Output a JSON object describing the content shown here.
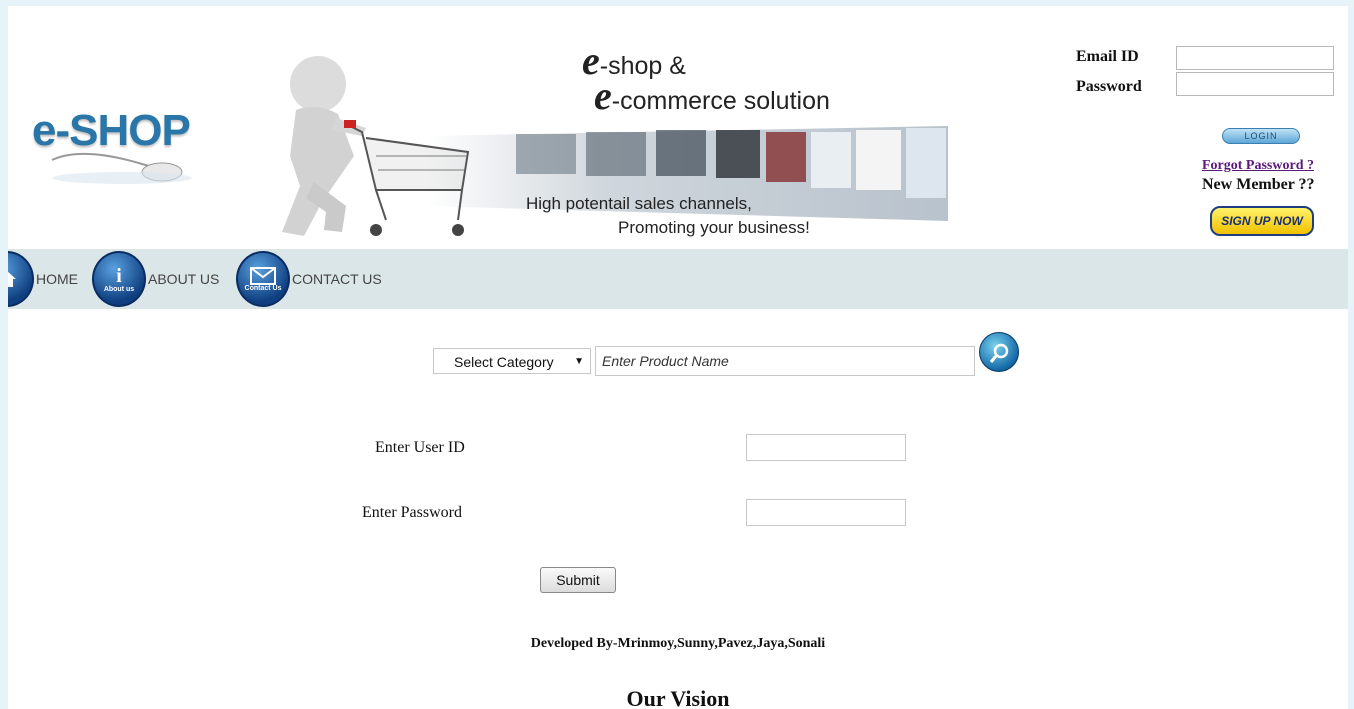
{
  "header": {
    "logo_text": "e-SHOP",
    "banner": {
      "line1_e": "e",
      "line1_text": "-shop &",
      "line2_e": "e",
      "line2_text": "-commerce solution",
      "tagline_line1": "High potentail sales channels,",
      "tagline_line2": "Promoting your business!"
    },
    "login": {
      "email_label": "Email ID",
      "password_label": "Password",
      "login_button": "LOGIN",
      "forgot_password": "Forgot Password ?",
      "new_member": "New Member ??",
      "signup_button": "SIGN UP NOW"
    }
  },
  "nav": {
    "home": "HOME",
    "about": "ABOUT US",
    "about_icon_text": "About us",
    "contact": "CONTACT US",
    "contact_icon_text": "Contact Us"
  },
  "search": {
    "category_selected": "Select Category",
    "product_placeholder": "Enter Product Name"
  },
  "login_form": {
    "user_id_label": "Enter User ID",
    "password_label": "Enter Password",
    "submit_label": "Submit"
  },
  "footer": {
    "credits": "Developed By-Mrinmoy,Sunny,Pavez,Jaya,Sonali",
    "vision_heading": "Our Vision"
  },
  "colors": {
    "outer_background": "#e6f4fa",
    "nav_background": "#dae6e8",
    "logo_blue": "#2a76a8",
    "link_purple": "#5a1a7a",
    "signup_yellow": "#f1c000"
  }
}
